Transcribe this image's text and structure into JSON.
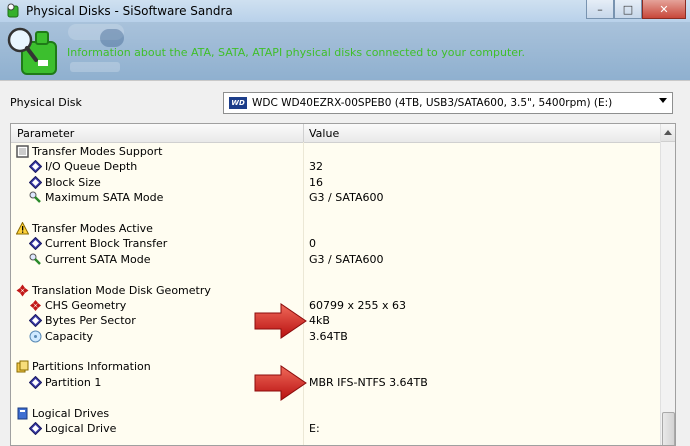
{
  "window": {
    "title": "Physical Disks - SiSoftware Sandra",
    "minimize_glyph": "–",
    "maximize_glyph": "□",
    "close_glyph": "✕"
  },
  "banner": {
    "text": "Information about the ATA, SATA, ATAPI physical disks connected to your computer."
  },
  "disk_selector": {
    "label": "Physical Disk",
    "value": "WDC WD40EZRX-00SPEB0 (4TB, USB3/SATA600, 3.5\", 5400rpm) (E:)",
    "logo_text": "WD"
  },
  "table": {
    "columns": {
      "parameter": "Parameter",
      "value": "Value"
    },
    "rows": [
      {
        "kind": "header",
        "icon": "transfer-modes-icon",
        "param": "Transfer Modes Support",
        "value": ""
      },
      {
        "kind": "item",
        "icon": "diamond-icon",
        "param": "I/O Queue Depth",
        "value": "32"
      },
      {
        "kind": "item",
        "icon": "diamond-icon",
        "param": "Block Size",
        "value": "16"
      },
      {
        "kind": "item",
        "icon": "probe-icon",
        "param": "Maximum SATA Mode",
        "value": "G3 / SATA600"
      },
      {
        "kind": "blank",
        "param": "",
        "value": ""
      },
      {
        "kind": "header",
        "icon": "warning-icon",
        "param": "Transfer Modes Active",
        "value": ""
      },
      {
        "kind": "item",
        "icon": "diamond-icon",
        "param": "Current Block Transfer",
        "value": "0"
      },
      {
        "kind": "item",
        "icon": "probe-icon",
        "param": "Current SATA Mode",
        "value": "G3 / SATA600"
      },
      {
        "kind": "blank",
        "param": "",
        "value": ""
      },
      {
        "kind": "header",
        "icon": "geometry-icon",
        "param": "Translation Mode Disk Geometry",
        "value": ""
      },
      {
        "kind": "item",
        "icon": "geometry-small-icon",
        "param": "CHS Geometry",
        "value": "60799 x 255 x 63"
      },
      {
        "kind": "item",
        "icon": "diamond-icon",
        "param": "Bytes Per Sector",
        "value": "4kB"
      },
      {
        "kind": "item",
        "icon": "capacity-icon",
        "param": "Capacity",
        "value": "3.64TB"
      },
      {
        "kind": "blank",
        "param": "",
        "value": ""
      },
      {
        "kind": "header",
        "icon": "partitions-icon",
        "param": "Partitions Information",
        "value": ""
      },
      {
        "kind": "item",
        "icon": "diamond-icon",
        "param": "Partition 1",
        "value": "MBR IFS-NTFS 3.64TB"
      },
      {
        "kind": "blank",
        "param": "",
        "value": ""
      },
      {
        "kind": "header",
        "icon": "logical-drives-icon",
        "param": "Logical Drives",
        "value": ""
      },
      {
        "kind": "item",
        "icon": "diamond-icon",
        "param": "Logical Drive",
        "value": "E:"
      }
    ]
  },
  "colors": {
    "banner_text": "#3fbf2a",
    "arrow_red": "#d81e1e",
    "grid_background": "#fffdf1"
  }
}
